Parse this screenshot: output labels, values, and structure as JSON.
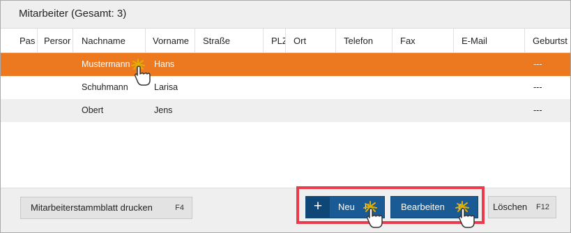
{
  "panel": {
    "title": "Mitarbeiter (Gesamt: 3)"
  },
  "columns": [
    "Pas",
    "Persor",
    "Nachname",
    "Vorname",
    "Straße",
    "PLZ",
    "Ort",
    "Telefon",
    "Fax",
    "E-Mail",
    "Geburtst"
  ],
  "rows": [
    {
      "nachname": "Mustermann",
      "vorname": "Hans",
      "geburtstag": "---",
      "selected": true
    },
    {
      "nachname": "Schuhmann",
      "vorname": "Larisa",
      "geburtstag": "---",
      "selected": false
    },
    {
      "nachname": "Obert",
      "vorname": "Jens",
      "geburtstag": "---",
      "selected": false
    }
  ],
  "footer": {
    "print": {
      "label": "Mitarbeiterstammblatt drucken",
      "key": "F4"
    },
    "new": {
      "icon": "plus-icon",
      "symbol": "+",
      "label": "Neu",
      "key": "F"
    },
    "edit": {
      "label": "Bearbeiten",
      "key": "F"
    },
    "delete": {
      "label": "Löschen",
      "key": "F12"
    }
  },
  "colors": {
    "selected_row": "#ec7820",
    "primary_button": "#1a5b96",
    "highlight_frame": "#ea3a4c"
  }
}
